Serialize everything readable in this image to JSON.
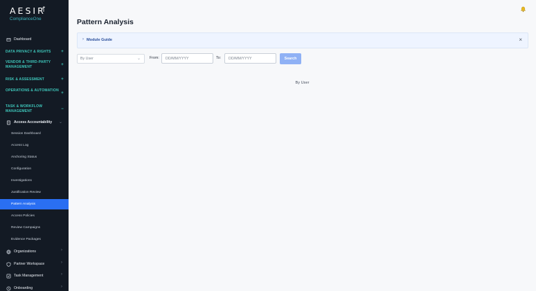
{
  "brand": {
    "name": "AESIR",
    "subtitle": "ComplianceOne"
  },
  "sidebar": {
    "dashboard": {
      "label": "Dashboard",
      "icon": "dashboard-icon"
    },
    "sections": [
      {
        "label": "DATA PRIVACY & RIGHTS",
        "sign": "+"
      },
      {
        "label": "VENDOR & THIRD-PARTY MANAGEMENT",
        "sign": "+"
      },
      {
        "label": "RISK & ASSESSMENT",
        "sign": "+"
      },
      {
        "label": "OPERATIONS & AUTOMATION",
        "sign": "+"
      },
      {
        "label": "TASK & WORKFLOW MANAGEMENT",
        "sign": "−"
      }
    ],
    "group": {
      "label": "Access Accountability",
      "icon": "access-icon"
    },
    "sub_items": [
      {
        "label": "Session Dashboard"
      },
      {
        "label": "Access Log"
      },
      {
        "label": "Anchoring Status"
      },
      {
        "label": "Configuration"
      },
      {
        "label": "Investigations"
      },
      {
        "label": "Justification Review"
      },
      {
        "label": "Pattern Analysis",
        "active": true
      },
      {
        "label": "Access Policies"
      },
      {
        "label": "Review Campaigns"
      },
      {
        "label": "Evidence Packages"
      }
    ],
    "bottom_items": [
      {
        "label": "Organizations",
        "icon": "globe-icon"
      },
      {
        "label": "Partner Workspace",
        "icon": "shield-icon"
      },
      {
        "label": "Task Management",
        "icon": "task-icon"
      },
      {
        "label": "Onboarding",
        "icon": "onboarding-icon"
      }
    ]
  },
  "header": {
    "title": "Pattern Analysis"
  },
  "guide": {
    "label": "Module Guide"
  },
  "filters": {
    "select_value": "By User",
    "from_label": "From:",
    "from_placeholder": "DD/MM/YYYY",
    "to_label": "To:",
    "to_placeholder": "DD/MM/YYYY",
    "search_label": "Search"
  },
  "content": {
    "by_user_label": "By User"
  },
  "colors": {
    "sidebar_bg": "#131a24",
    "accent": "#2a6ff2",
    "section": "#3fc9bd",
    "search_btn": "#8fb1f5"
  }
}
